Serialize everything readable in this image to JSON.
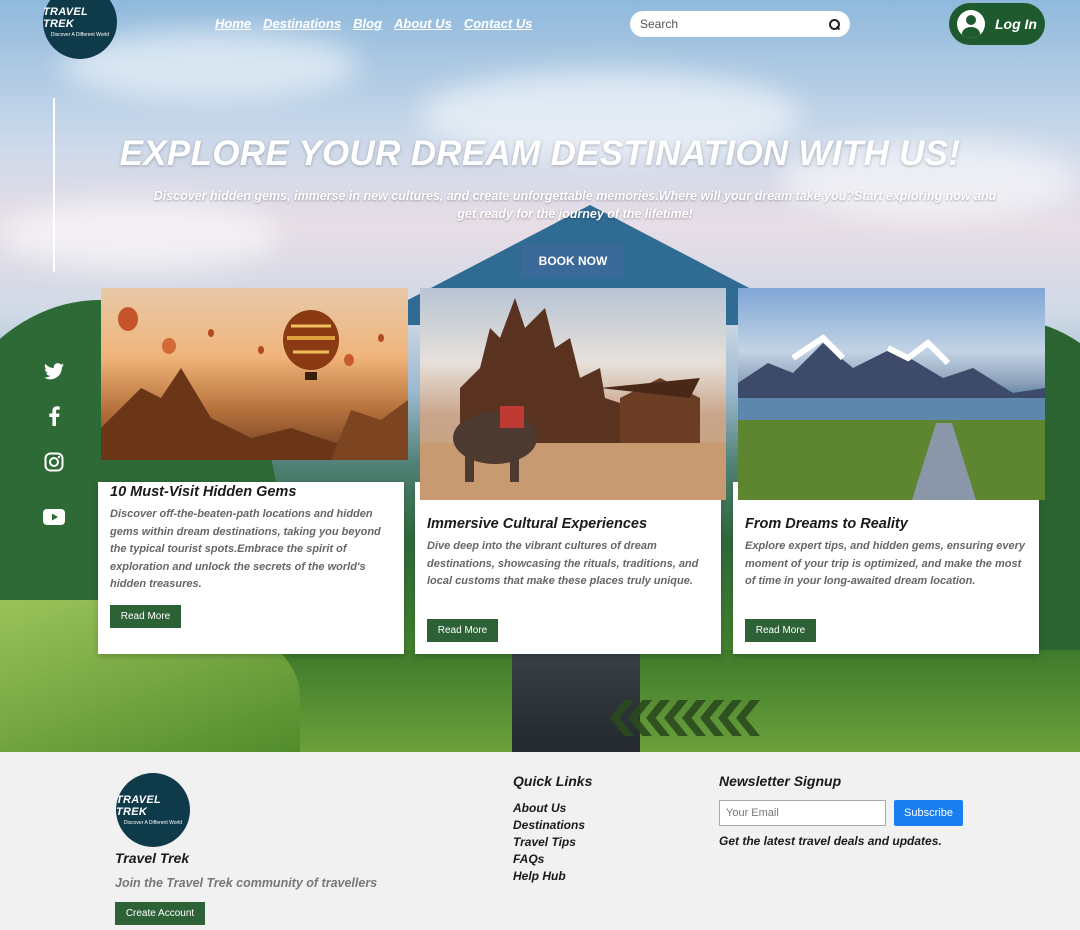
{
  "header": {
    "logo": {
      "name": "TRAVEL TREK",
      "tagline": "Discover A Different World"
    },
    "nav": [
      "Home",
      "Destinations",
      "Blog",
      "About Us",
      "Contact Us"
    ],
    "search_placeholder": "Search",
    "login_label": "Log In"
  },
  "social": [
    "twitter-icon",
    "facebook-icon",
    "instagram-icon",
    "youtube-icon"
  ],
  "hero": {
    "title": "EXPLORE YOUR DREAM DESTINATION WITH US!",
    "subtitle": "Discover hidden gems, immerse in new cultures, and create unforgettable memories.Where will your dream take you?Start exploring now and get ready for the journey of the lifetime!",
    "cta": "BOOK NOW"
  },
  "cards": [
    {
      "title": "10 Must-Visit Hidden Gems",
      "text": "Discover off-the-beaten-path locations and hidden gems within dream destinations, taking you beyond the typical tourist spots.Embrace the spirit of exploration and unlock the secrets of the world's hidden treasures.",
      "button": "Read More"
    },
    {
      "title": "Immersive Cultural Experiences",
      "text": "Dive deep into the vibrant cultures of dream destinations, showcasing the rituals, traditions, and local customs that make these places truly unique.",
      "button": "Read More"
    },
    {
      "title": "From Dreams to Reality",
      "text": "Explore expert tips, and hidden gems, ensuring every moment of your trip is optimized, and make the most of time in your long-awaited dream location.",
      "button": "Read More"
    }
  ],
  "footer": {
    "brand": "Travel Trek",
    "join_text": "Join the Travel Trek community of travellers",
    "create_button": "Create Account",
    "quick_links_title": "Quick Links",
    "quick_links": [
      "About Us",
      "Destinations",
      "Travel Tips",
      "FAQs",
      "Help Hub"
    ],
    "newsletter_title": "Newsletter Signup",
    "email_placeholder": "Your Email",
    "subscribe_label": "Subscribe",
    "deals_text": "Get the latest travel deals and updates."
  },
  "colors": {
    "brand_green": "#2d6236",
    "login_green": "#1f5a2f",
    "book_blue": "#3b6a9a",
    "subscribe_blue": "#1a7df0",
    "logo_navy": "#0f3a4a"
  }
}
